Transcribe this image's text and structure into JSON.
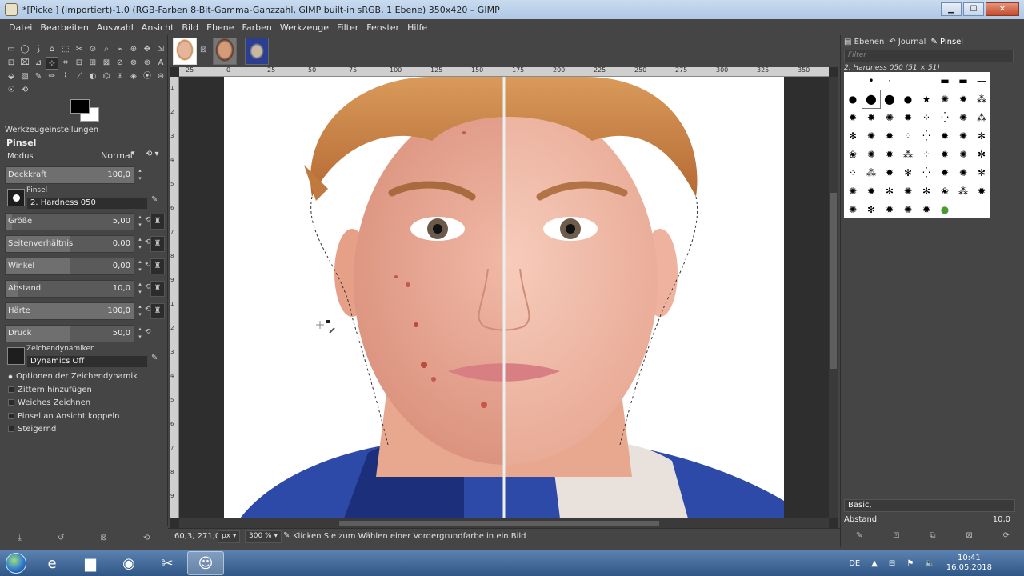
{
  "window": {
    "title": "*[Pickel] (importiert)-1.0 (RGB-Farben 8-Bit-Gamma-Ganzzahl, GIMP built-in sRGB, 1 Ebene) 350x420 – GIMP",
    "minimize": "▁",
    "maximize": "☐",
    "close": "✕"
  },
  "menu": [
    "Datei",
    "Bearbeiten",
    "Auswahl",
    "Ansicht",
    "Bild",
    "Ebene",
    "Farben",
    "Werkzeuge",
    "Filter",
    "Fenster",
    "Hilfe"
  ],
  "toolbox": {
    "tools": [
      "▭",
      "◯",
      "⟆",
      "⌂",
      "⬚",
      "✂",
      "⊙",
      "⌕",
      "⌁",
      "⊕",
      "✥",
      "⇲",
      "⊡",
      "⌧",
      "⊿",
      "⊹",
      "⌗",
      "⊟",
      "⊞",
      "⊠",
      "⊘",
      "⊗",
      "⊚",
      "A",
      "⬙",
      "▨",
      "✎",
      "✏",
      "⌇",
      "⟋",
      "◐",
      "⌬",
      "⍟",
      "◈",
      "⦿",
      "⊜",
      "☉",
      "⟲"
    ],
    "active_tool_index": 15,
    "fg_color": "#000000",
    "bg_color": "#ffffff"
  },
  "tool_options": {
    "tab_label": "Werkzeugeinstellungen",
    "tool_name": "Pinsel",
    "mode_label": "Modus",
    "mode_value": "Normal",
    "opacity": {
      "label": "Deckkraft",
      "value": "100,0",
      "fraction": 1.0
    },
    "brush": {
      "small_label": "Pinsel",
      "name": "2. Hardness 050"
    },
    "sliders": [
      {
        "label": "Größe",
        "value": "5,00",
        "fraction": 0.05
      },
      {
        "label": "Seitenverhältnis",
        "value": "0,00",
        "fraction": 0.5
      },
      {
        "label": "Winkel",
        "value": "0,00",
        "fraction": 0.5
      },
      {
        "label": "Abstand",
        "value": "10,0",
        "fraction": 0.1
      },
      {
        "label": "Härte",
        "value": "100,0",
        "fraction": 1.0
      },
      {
        "label": "Druck",
        "value": "50,0",
        "fraction": 0.5
      }
    ],
    "dynamics": {
      "small_label": "Zeichendynamiken",
      "name": "Dynamics Off"
    },
    "checks": [
      {
        "label": "Optionen der Zeichendynamik",
        "checked": true
      },
      {
        "label": "Zittern hinzufügen",
        "checked": false
      },
      {
        "label": "Weiches Zeichnen",
        "checked": false
      },
      {
        "label": "Pinsel an Ansicht koppeln",
        "checked": false
      },
      {
        "label": "Steigernd",
        "checked": false
      }
    ]
  },
  "ruler_top": [
    "25",
    "0",
    "25",
    "50",
    "75",
    "100",
    "125",
    "150",
    "175",
    "200",
    "225",
    "250",
    "275",
    "300",
    "325",
    "350"
  ],
  "ruler_left": [
    "1",
    "2",
    "3",
    "4",
    "5",
    "6",
    "7",
    "8",
    "9",
    "1",
    "2",
    "3",
    "4",
    "5",
    "6",
    "7",
    "8",
    "9"
  ],
  "status": {
    "coords": "60,3, 271,0",
    "unit": "px",
    "zoom": "300 %",
    "message": "Klicken Sie zum Wählen einer Vordergrundfarbe in ein Bild"
  },
  "right_dock": {
    "tabs": [
      "Ebenen",
      "Journal",
      "Pinsel"
    ],
    "active_tab": "Pinsel",
    "filter_placeholder": "Filter",
    "brush_title": "2. Hardness 050 (51 × 51)",
    "tag": "Basic,",
    "spacing_label": "Abstand",
    "spacing_value": "10,0"
  },
  "taskbar": {
    "lang": "DE",
    "time": "10:41",
    "date": "16.05.2018"
  }
}
